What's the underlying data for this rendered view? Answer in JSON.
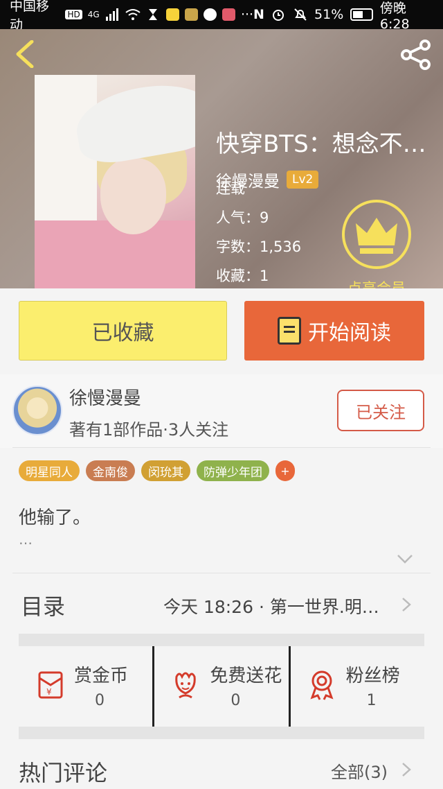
{
  "status_bar": {
    "carrier": "中国移动",
    "hd": "HD",
    "network": "4G",
    "battery": "51%",
    "time": "傍晚6:28"
  },
  "book": {
    "title": "快穿BTS：想念不…",
    "author": "徐慢漫曼",
    "level": "Lv2",
    "status": "连载",
    "popularity": "人气：9",
    "word_count": "字数：1,536",
    "collections": "收藏：1",
    "vip_label": "点亮会员"
  },
  "actions": {
    "collected_label": "已收藏",
    "read_label": "开始阅读"
  },
  "author_info": {
    "name": "徐慢漫曼",
    "stats": "著有1部作品·3人关注",
    "follow_label": "已关注"
  },
  "tags": [
    {
      "label": "明星同人",
      "color": "#e8ab3a"
    },
    {
      "label": "金南俊",
      "color": "#c97d52"
    },
    {
      "label": "闵玧其",
      "color": "#d1a033"
    },
    {
      "label": "防弹少年团",
      "color": "#8fb24c"
    }
  ],
  "tag_more": "+",
  "description": {
    "text": "他输了。",
    "more": "…"
  },
  "catalog": {
    "title": "目录",
    "latest": "今天 18:26 · 第一世界.明…"
  },
  "stats": [
    {
      "label": "赏金币",
      "value": "0",
      "icon": "red-envelope-icon"
    },
    {
      "label": "免费送花",
      "value": "0",
      "icon": "flower-icon"
    },
    {
      "label": "粉丝榜",
      "value": "1",
      "icon": "medal-icon"
    }
  ],
  "comments": {
    "title": "热门评论",
    "all_label": "全部(3)"
  },
  "colors": {
    "accent_orange": "#e8673a",
    "collected_yellow": "#fbee6e",
    "vip_yellow": "#f6e05c",
    "follow_red": "#d45a47"
  }
}
